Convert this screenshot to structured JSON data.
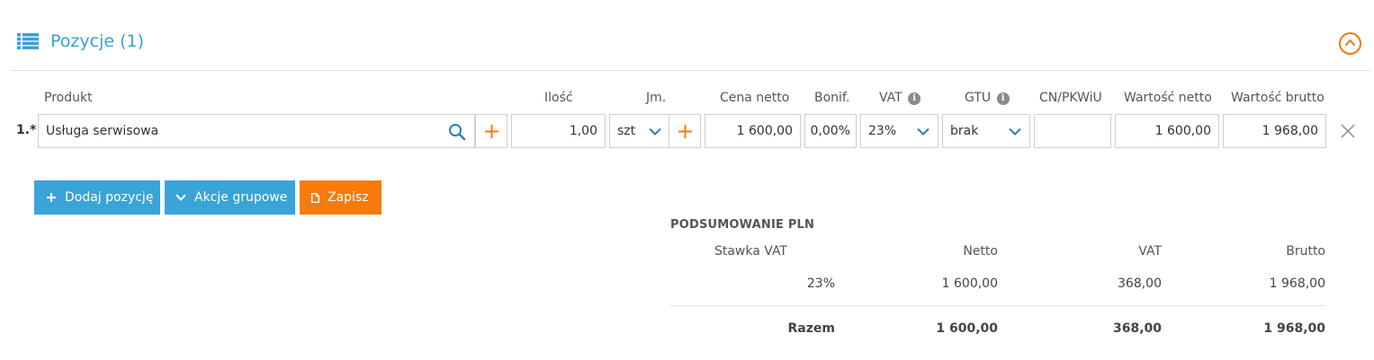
{
  "section": {
    "title": "Pozycje (1)",
    "accent_color": "#3a9fd2",
    "collapse_icon": "chevron-up-circle-icon"
  },
  "columns": {
    "product": "Produkt",
    "quantity": "Ilość",
    "unit": "Jm.",
    "net_price": "Cena netto",
    "discount": "Bonif.",
    "vat": "VAT",
    "gtu": "GTU",
    "cn_pkwiu": "CN/PKWiU",
    "net_value": "Wartość netto",
    "gross_value": "Wartość brutto"
  },
  "item": {
    "number": "1.*",
    "product": "Usługa serwisowa",
    "quantity": "1,00",
    "unit": "szt",
    "net_price": "1 600,00",
    "discount": "0,00%",
    "vat": "23%",
    "gtu": "brak",
    "cn_pkwiu": "",
    "net_value": "1 600,00",
    "gross_value": "1 968,00"
  },
  "buttons": {
    "add_item": "Dodaj pozycję",
    "bulk_actions": "Akcje grupowe",
    "save": "Zapisz"
  },
  "summary": {
    "title": "PODSUMOWANIE PLN",
    "headers": {
      "rate": "Stawka VAT",
      "net": "Netto",
      "vat": "VAT",
      "gross": "Brutto"
    },
    "rows": [
      {
        "rate": "23%",
        "net": "1 600,00",
        "vat": "368,00",
        "gross": "1 968,00"
      }
    ],
    "total": {
      "label": "Razem",
      "net": "1 600,00",
      "vat": "368,00",
      "gross": "1 968,00"
    }
  },
  "colors": {
    "blue": "#3aa3d8",
    "orange": "#f77a0c",
    "icon_blue": "#2a7fb8"
  }
}
